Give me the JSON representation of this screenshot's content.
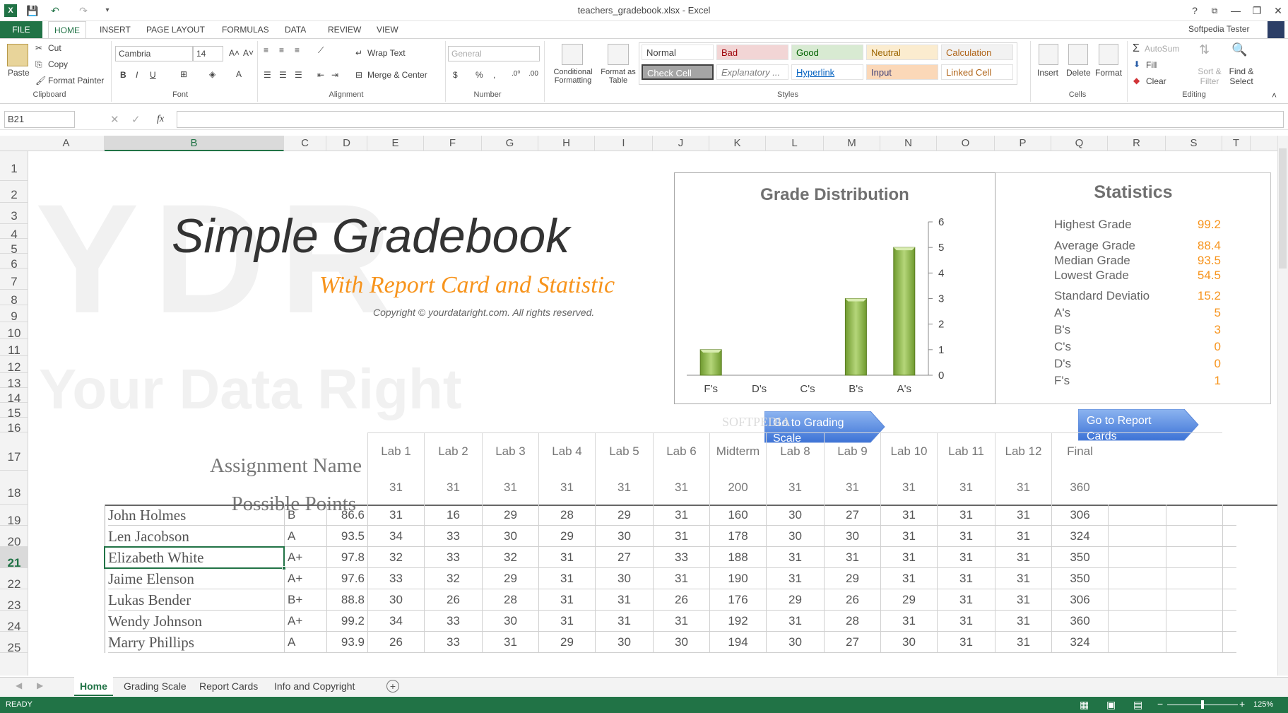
{
  "window": {
    "title": "teachers_gradebook.xlsx - Excel",
    "user": "Softpedia Tester",
    "help": "?",
    "minimize": "—",
    "restore": "❐",
    "close": "✕"
  },
  "tabs": {
    "file": "FILE",
    "items": [
      "HOME",
      "INSERT",
      "PAGE LAYOUT",
      "FORMULAS",
      "DATA",
      "REVIEW",
      "VIEW"
    ]
  },
  "ribbon": {
    "clipboard": {
      "paste": "Paste",
      "cut": "Cut",
      "copy": "Copy",
      "format_painter": "Format Painter",
      "group": "Clipboard"
    },
    "font": {
      "name": "Cambria",
      "size": "14",
      "group": "Font",
      "bold": "B",
      "italic": "I",
      "underline": "U"
    },
    "alignment": {
      "wrap": "Wrap Text",
      "merge": "Merge & Center",
      "group": "Alignment"
    },
    "number": {
      "format": "General",
      "group": "Number",
      "currency": "$",
      "percent": "%",
      "comma": ","
    },
    "styles_cmds": {
      "conditional": "Conditional Formatting",
      "format_table": "Format as Table",
      "group": "Styles"
    },
    "styles": [
      "Normal",
      "Bad",
      "Good",
      "Neutral",
      "Calculation",
      "Check Cell",
      "Explanatory ...",
      "Hyperlink",
      "Input",
      "Linked Cell"
    ],
    "cells": {
      "insert": "Insert",
      "delete": "Delete",
      "format": "Format",
      "group": "Cells"
    },
    "editing": {
      "autosum": "AutoSum",
      "fill": "Fill",
      "clear": "Clear",
      "sort": "Sort & Filter",
      "find": "Find & Select",
      "group": "Editing"
    }
  },
  "formula_bar": {
    "name_box": "B21",
    "fx": "fx",
    "content": ""
  },
  "columns": [
    "A",
    "B",
    "C",
    "D",
    "E",
    "F",
    "G",
    "H",
    "I",
    "J",
    "K",
    "L",
    "M",
    "N",
    "O",
    "P",
    "Q",
    "R",
    "S",
    "T"
  ],
  "rows": [
    "1",
    "2",
    "3",
    "4",
    "5",
    "6",
    "7",
    "8",
    "9",
    "10",
    "11",
    "12",
    "13",
    "14",
    "15",
    "16",
    "17",
    "18",
    "19",
    "20",
    "21",
    "22",
    "23",
    "24",
    "25"
  ],
  "sheet": {
    "watermark_big": "YDR",
    "watermark_text": "Your Data Right",
    "title": "Simple Gradebook",
    "subtitle": "With Report Card and Statistic",
    "copyright": "Copyright © yourdataright.com. All rights reserved.",
    "btn_grading": "Go to Grading Scale",
    "btn_report": "Go to Report Cards",
    "softpedia": "SOFTPEDIA"
  },
  "chart_data": {
    "type": "bar",
    "title": "Grade Distribution",
    "categories": [
      "F's",
      "D's",
      "C's",
      "B's",
      "A's"
    ],
    "values": [
      1,
      0,
      0,
      3,
      5
    ],
    "ylim": [
      0,
      6
    ],
    "yticks": [
      "0",
      "1",
      "2",
      "3",
      "4",
      "5",
      "6"
    ],
    "color": "#8db346"
  },
  "statistics": {
    "title": "Statistics",
    "items": [
      {
        "label": "Highest Grade",
        "value": "99.2"
      },
      {
        "label": "Average Grade",
        "value": "88.4"
      },
      {
        "label": "Median Grade",
        "value": "93.5"
      },
      {
        "label": "Lowest Grade",
        "value": "54.5"
      },
      {
        "label": "Standard Deviatio",
        "value": "15.2"
      },
      {
        "label": "A's",
        "value": "5"
      },
      {
        "label": "B's",
        "value": "3"
      },
      {
        "label": "C's",
        "value": "0"
      },
      {
        "label": "D's",
        "value": "0"
      },
      {
        "label": "F's",
        "value": "1"
      }
    ]
  },
  "gradebook": {
    "assignment_label": "Assignment Name",
    "points_label": "Possible Points",
    "assignments": [
      "Lab 1",
      "Lab 2",
      "Lab 3",
      "Lab 4",
      "Lab 5",
      "Lab 6",
      "Midterm",
      "Lab 8",
      "Lab 9",
      "Lab 10",
      "Lab 11",
      "Lab 12",
      "Final"
    ],
    "possible": [
      "31",
      "31",
      "31",
      "31",
      "31",
      "31",
      "200",
      "31",
      "31",
      "31",
      "31",
      "31",
      "360"
    ],
    "students": [
      {
        "name": "John Holmes",
        "grade": "B",
        "pct": "86.6",
        "scores": [
          "31",
          "16",
          "29",
          "28",
          "29",
          "31",
          "160",
          "30",
          "27",
          "31",
          "31",
          "31",
          "306"
        ]
      },
      {
        "name": "Len Jacobson",
        "grade": "A",
        "pct": "93.5",
        "scores": [
          "34",
          "33",
          "30",
          "29",
          "30",
          "31",
          "178",
          "30",
          "30",
          "31",
          "31",
          "31",
          "324"
        ]
      },
      {
        "name": "Elizabeth White",
        "grade": "A+",
        "pct": "97.8",
        "scores": [
          "32",
          "33",
          "32",
          "31",
          "27",
          "33",
          "188",
          "31",
          "31",
          "31",
          "31",
          "31",
          "350"
        ]
      },
      {
        "name": "Jaime Elenson",
        "grade": "A+",
        "pct": "97.6",
        "scores": [
          "33",
          "32",
          "29",
          "31",
          "30",
          "31",
          "190",
          "31",
          "29",
          "31",
          "31",
          "31",
          "350"
        ]
      },
      {
        "name": "Lukas Bender",
        "grade": "B+",
        "pct": "88.8",
        "scores": [
          "30",
          "26",
          "28",
          "31",
          "31",
          "26",
          "176",
          "29",
          "26",
          "29",
          "31",
          "31",
          "306"
        ]
      },
      {
        "name": "Wendy Johnson",
        "grade": "A+",
        "pct": "99.2",
        "scores": [
          "34",
          "33",
          "30",
          "31",
          "31",
          "31",
          "192",
          "31",
          "28",
          "31",
          "31",
          "31",
          "360"
        ]
      },
      {
        "name": "Marry Phillips",
        "grade": "A",
        "pct": "93.9",
        "scores": [
          "26",
          "33",
          "31",
          "29",
          "30",
          "30",
          "194",
          "30",
          "27",
          "30",
          "31",
          "31",
          "324"
        ]
      }
    ]
  },
  "sheet_tabs": [
    "Home",
    "Grading Scale",
    "Report Cards",
    "Info and Copyright"
  ],
  "status": {
    "ready": "READY",
    "zoom": "125%"
  }
}
